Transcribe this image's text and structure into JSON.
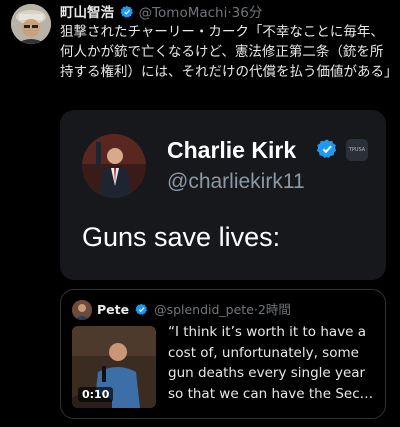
{
  "tweet": {
    "display_name": "町山智浩",
    "handle": "@TomoMachi",
    "separator": "·",
    "time": "36分",
    "text": "狙撃されたチャーリー・カーク「不幸なことに毎年、何人かが銃で亡くなるけど、憲法修正第二条（銃を所持する権利）には、それだけの代償を払う価値がある」"
  },
  "embedded_card": {
    "name": "Charlie Kirk",
    "handle": "@charliekirk11",
    "body": "Guns save lives:",
    "verified_color": "#1d9bf0",
    "logo_text": "TPUSA"
  },
  "quoted_tweet": {
    "display_name": "Pete",
    "handle": "@splendid_pete",
    "separator": "·",
    "time": "2時間",
    "text": "“I think it’s worth it to have a cost of, unfortunately, some gun deaths every single year so that we can have the Sec…",
    "video_duration": "0:10"
  },
  "colors": {
    "background": "#000000",
    "text": "#e7e9ea",
    "muted": "#71767b",
    "card_bg": "#16181c",
    "verified": "#1d9bf0"
  }
}
